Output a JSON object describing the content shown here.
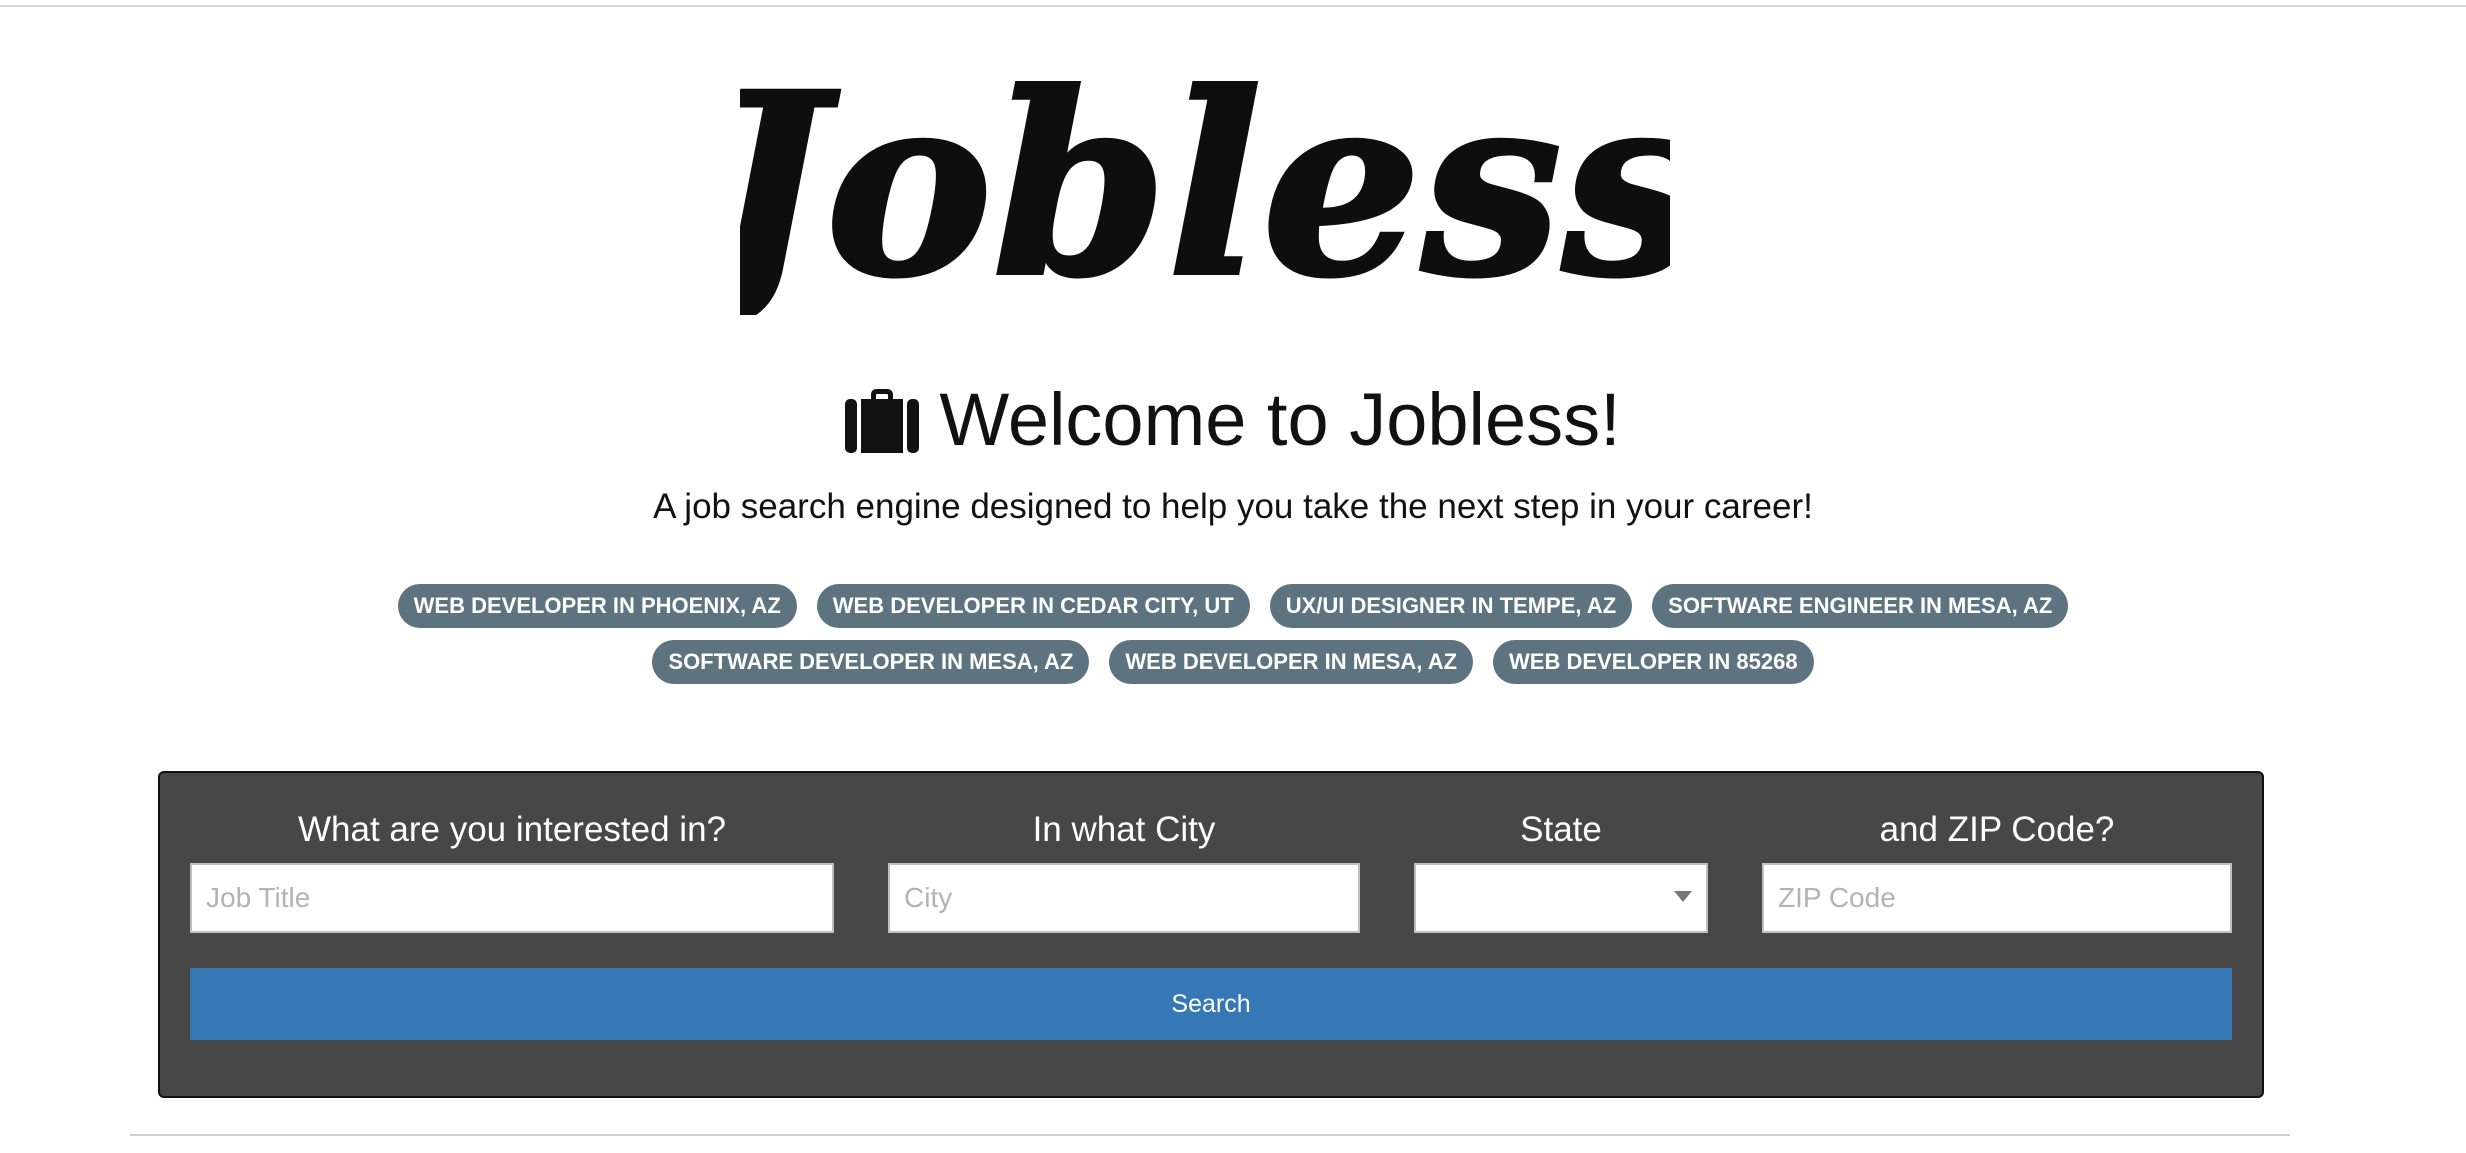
{
  "logo": {
    "text": "Jobless"
  },
  "hero": {
    "icon": "briefcase-icon",
    "title": "Welcome to Jobless!",
    "subtitle": "A job search engine designed to help you take the next step in your career!"
  },
  "recent_searches": [
    [
      "WEB DEVELOPER IN PHOENIX, AZ",
      "WEB DEVELOPER IN CEDAR CITY, UT",
      "UX/UI DESIGNER IN TEMPE, AZ",
      "SOFTWARE ENGINEER IN MESA, AZ"
    ],
    [
      "SOFTWARE DEVELOPER IN MESA, AZ",
      "WEB DEVELOPER IN MESA, AZ",
      "WEB DEVELOPER IN 85268"
    ]
  ],
  "search_form": {
    "job_label": "What are you interested in?",
    "job_placeholder": "Job Title",
    "job_value": "",
    "city_label": "In what City",
    "city_placeholder": "City",
    "city_value": "",
    "state_label": "State",
    "state_value": "",
    "zip_label": "and ZIP Code?",
    "zip_placeholder": "ZIP Code",
    "zip_value": "",
    "submit_label": "Search"
  },
  "colors": {
    "chip_bg": "#5e7380",
    "panel_bg": "#474747",
    "button_bg": "#3677b6"
  }
}
